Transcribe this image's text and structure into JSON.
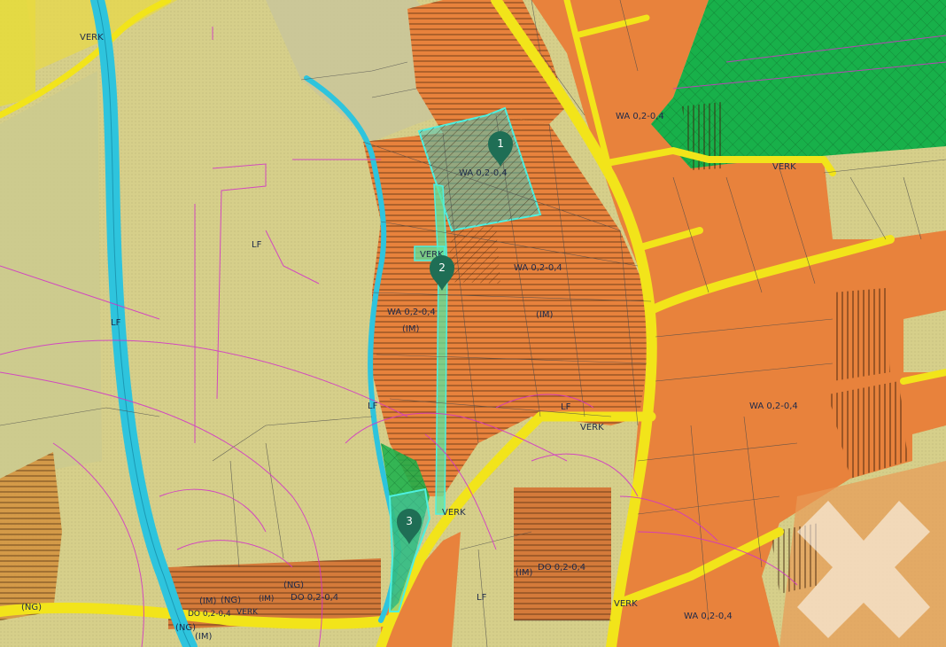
{
  "map": {
    "colors": {
      "agri_land": "#d6cf8a",
      "agri_light": "#cfcc9a",
      "residential": "#e8823c",
      "residential_dark": "#d47a3a",
      "road": "#f2e41a",
      "stream": "#2ec4dd",
      "green_zone": "#18b04a",
      "highlight": "#4ec7b7",
      "parcel_line": "#4a4a4a",
      "magenta_line": "#d233c8",
      "pin": "#1f6e55",
      "watermark": "#ffffff"
    },
    "labels": [
      {
        "text": "VERK"
      },
      {
        "text": "VERK"
      },
      {
        "text": "VERK"
      },
      {
        "text": "VERK"
      },
      {
        "text": "VERK"
      },
      {
        "text": "VERK"
      },
      {
        "text": "VERK"
      },
      {
        "text": "LF"
      },
      {
        "text": "LF"
      },
      {
        "text": "LF"
      },
      {
        "text": "LF"
      },
      {
        "text": "LF"
      },
      {
        "text": "WA 0,2-0,4"
      },
      {
        "text": "WA 0,2-0,4"
      },
      {
        "text": "WA 0,2-0,4"
      },
      {
        "text": "WA 0,2-0,4"
      },
      {
        "text": "WA 0,2-0,4"
      },
      {
        "text": "WA 0,2-0,4"
      },
      {
        "text": "(IM)"
      },
      {
        "text": "(IM)"
      },
      {
        "text": "(IM)"
      },
      {
        "text": "(IM)"
      },
      {
        "text": "(IM)"
      },
      {
        "text": "(NG)"
      },
      {
        "text": "(NG)"
      },
      {
        "text": "(NG)"
      },
      {
        "text": "(NG)"
      },
      {
        "text": "DO 0,2-0,4"
      },
      {
        "text": "DO 0,2-0,4"
      },
      {
        "text": "DO 0,2-0,4"
      }
    ],
    "markers": [
      {
        "label": "1"
      },
      {
        "label": "2"
      },
      {
        "label": "3"
      }
    ],
    "watermark_icon": "raiffeisen-cross-icon"
  }
}
